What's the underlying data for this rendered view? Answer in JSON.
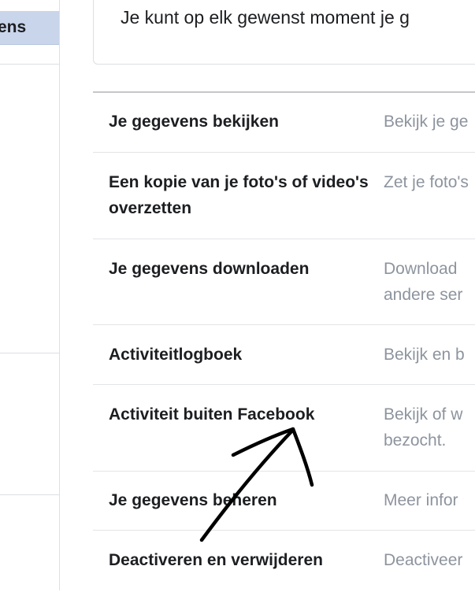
{
  "sidebar": {
    "active_item_label": "ens"
  },
  "info": {
    "text": "Je kunt op elk gewenst moment je g"
  },
  "settings": {
    "rows": [
      {
        "title": "Je gegevens bekijken",
        "desc": "Bekijk je ge"
      },
      {
        "title": "Een kopie van je foto's of video's overzetten",
        "desc": "Zet je foto's"
      },
      {
        "title": "Je gegevens downloaden",
        "desc": "Download andere ser"
      },
      {
        "title": "Activiteitlogboek",
        "desc": "Bekijk en b"
      },
      {
        "title": "Activiteit buiten Facebook",
        "desc": "Bekijk of w bezocht."
      },
      {
        "title": "Je gegevens beheren",
        "desc": "Meer infor"
      },
      {
        "title": "Deactiveren en verwijderen",
        "desc": "Deactiveer"
      }
    ]
  },
  "annotation": {
    "color": "#000000"
  }
}
